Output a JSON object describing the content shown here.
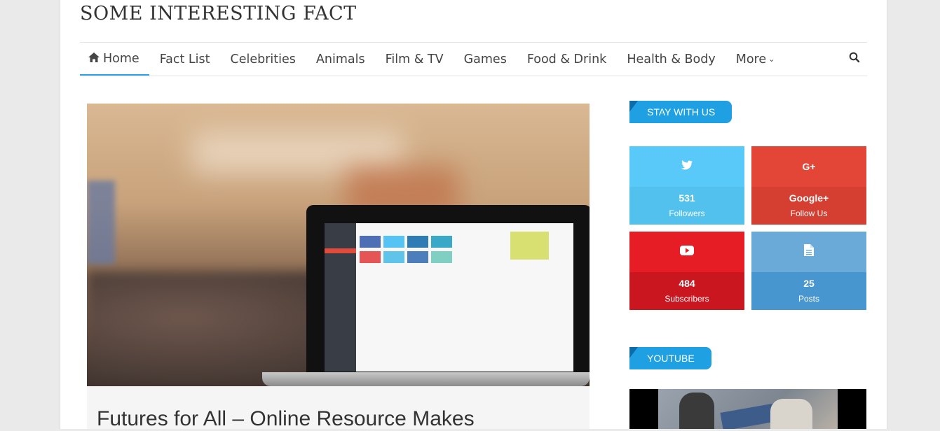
{
  "site": {
    "title": "SOME INTERESTING FACT"
  },
  "nav": {
    "items": [
      {
        "label": "Home",
        "icon": "home-icon"
      },
      {
        "label": "Fact List"
      },
      {
        "label": "Celebrities"
      },
      {
        "label": "Animals"
      },
      {
        "label": "Film & TV"
      },
      {
        "label": "Games"
      },
      {
        "label": "Food & Drink"
      },
      {
        "label": "Health & Body"
      },
      {
        "label": "More"
      }
    ],
    "active_color": "#28a5e6"
  },
  "article": {
    "title": "Futures for All – Online Resource Makes"
  },
  "sidebar": {
    "stay_title": "STAY WITH US",
    "social": [
      {
        "icon": "twitter-icon",
        "count": "531",
        "label": "Followers",
        "color": "#58c9f8"
      },
      {
        "icon": "google-plus-icon",
        "count": "Google+",
        "label": "Follow Us",
        "color": "#e34537"
      },
      {
        "icon": "youtube-icon",
        "count": "484",
        "label": "Subscribers",
        "color": "#e61d25"
      },
      {
        "icon": "posts-icon",
        "count": "25",
        "label": "Posts",
        "color": "#6aaad9"
      }
    ],
    "youtube_title": "YOUTUBE"
  },
  "colors": {
    "widget_title": "#1fa0e3"
  }
}
